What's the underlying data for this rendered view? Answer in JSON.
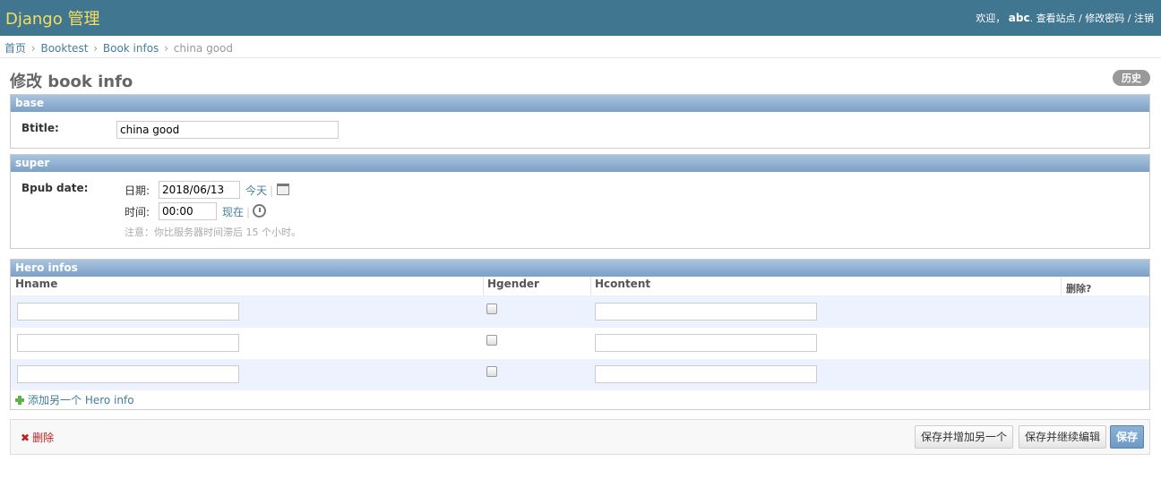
{
  "header": {
    "branding": "Django 管理",
    "welcome": "欢迎，",
    "username": "abc",
    "view_site": "查看站点",
    "change_password": "修改密码",
    "logout": "注销",
    "separator": "/"
  },
  "breadcrumbs": {
    "home": "首页",
    "app": "Booktest",
    "model": "Book infos",
    "current": "china good",
    "sep": "›"
  },
  "page": {
    "title": "修改 book info",
    "history": "历史"
  },
  "base": {
    "heading": "base",
    "btitle_label": "Btitle:",
    "btitle_value": "china good"
  },
  "super": {
    "heading": "super",
    "bpub_label": "Bpub date:",
    "date_label": "日期:",
    "date_value": "2018/06/13",
    "today": "今天",
    "time_label": "时间:",
    "time_value": "00:00",
    "now": "现在",
    "pipe": "|",
    "note": "注意：你比服务器时间滞后 15 个小时。"
  },
  "hero": {
    "heading": "Hero infos",
    "columns": [
      "Hname",
      "Hgender",
      "Hcontent",
      "删除?"
    ],
    "rows": [
      {
        "hname": "",
        "hgender": false,
        "hcontent": ""
      },
      {
        "hname": "",
        "hgender": false,
        "hcontent": ""
      },
      {
        "hname": "",
        "hgender": false,
        "hcontent": ""
      }
    ],
    "add_another": "添加另一个 Hero info"
  },
  "submit": {
    "delete": "删除",
    "save_add_another": "保存并增加另一个",
    "save_continue": "保存并继续编辑",
    "save": "保存"
  },
  "colors": {
    "header_bg": "#417690",
    "branding": "#f5dd5d",
    "link": "#447e9b",
    "module_header": "#7ca0c7",
    "row_alt": "#edf3fe",
    "delete": "#ba2121"
  }
}
